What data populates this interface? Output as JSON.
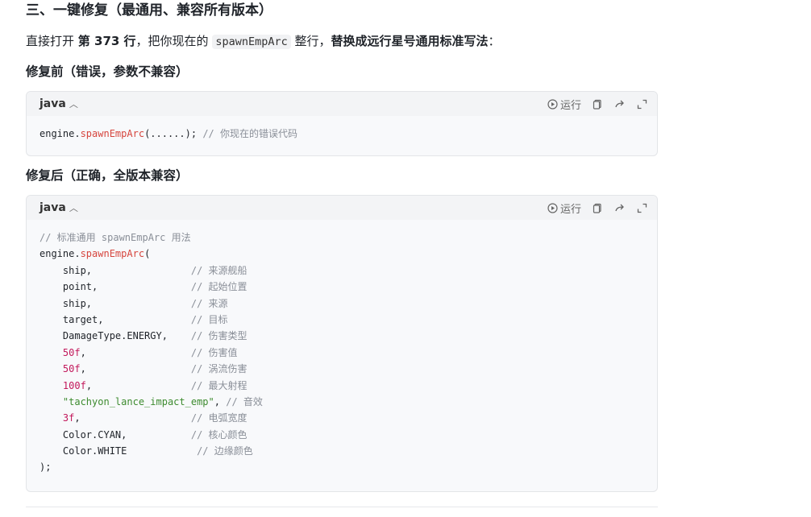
{
  "heading": "三、一键修复（最通用、兼容所有版本）",
  "intro": {
    "t1": "直接打开 ",
    "b1": "第 373 行",
    "t2": "，把你现在的 ",
    "code": "spawnEmpArc",
    "t3": " 整行，",
    "b2": "替换成远行星号通用标准写法",
    "t4": "："
  },
  "before": {
    "heading": "修复前（错误，参数不兼容）",
    "lang": "java",
    "run_label": "运行",
    "line": {
      "obj": "engine.",
      "fn": "spawnEmpArc",
      "args": "(......);",
      "comment": " // 你现在的错误代码"
    }
  },
  "after": {
    "heading": "修复后（正确，全版本兼容）",
    "lang": "java",
    "run_label": "运行",
    "header_comment": "// 标准通用 spawnEmpArc 用法",
    "call_obj": "engine.",
    "call_fn": "spawnEmpArc",
    "call_paren": "(",
    "args": [
      {
        "code": "    ship,",
        "pad": "                 ",
        "comment": "// 来源舰船"
      },
      {
        "code": "    point,",
        "pad": "                ",
        "comment": "// 起始位置"
      },
      {
        "code": "    ship,",
        "pad": "                 ",
        "comment": "// 来源"
      },
      {
        "code": "    target,",
        "pad": "               ",
        "comment": "// 目标"
      },
      {
        "code": "    DamageType.ENERGY,",
        "pad": "    ",
        "comment": "// 伤害类型"
      },
      {
        "num": "50f",
        "rest": ",",
        "pad": "                  ",
        "comment": "// 伤害值"
      },
      {
        "num": "50f",
        "rest": ",",
        "pad": "                  ",
        "comment": "// 涡流伤害"
      },
      {
        "num": "100f",
        "rest": ",",
        "pad": "                 ",
        "comment": "// 最大射程"
      },
      {
        "str": "\"tachyon_lance_impact_emp\"",
        "rest": ",",
        "pad": " ",
        "comment": "// 音效"
      },
      {
        "num": "3f",
        "rest": ",",
        "pad": "                   ",
        "comment": "// 电弧宽度"
      },
      {
        "code": "    Color.CYAN,",
        "pad": "           ",
        "comment": "// 核心颜色"
      },
      {
        "code": "    Color.WHITE",
        "pad": "            ",
        "comment": "// 边缘颜色"
      }
    ],
    "close": ");"
  }
}
